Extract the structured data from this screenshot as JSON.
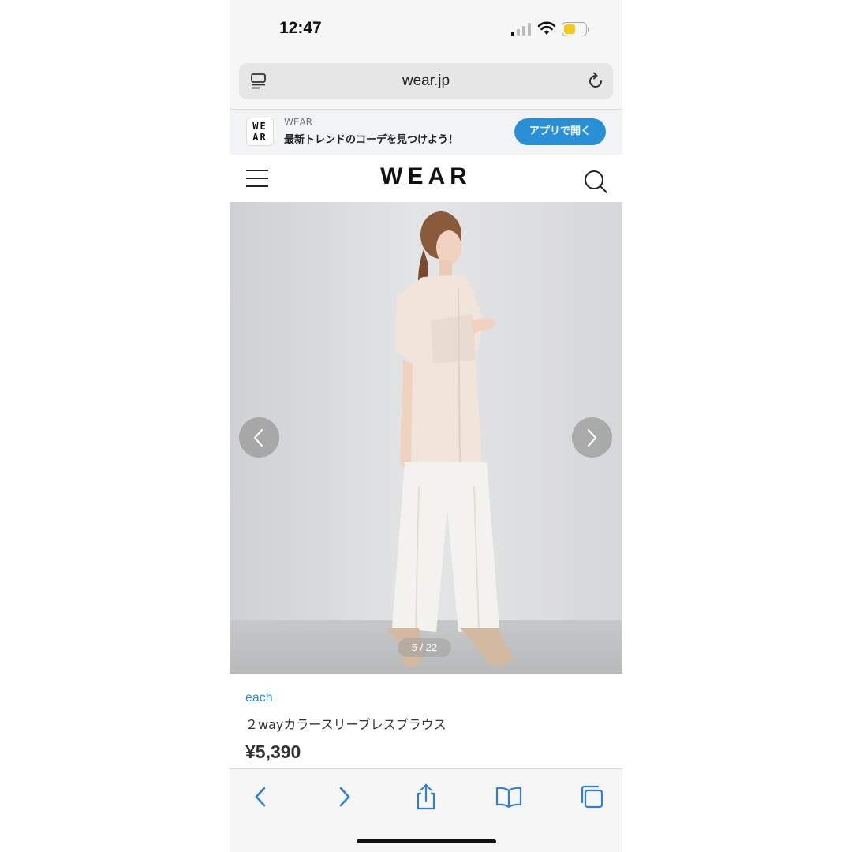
{
  "status_bar": {
    "time": "12:47"
  },
  "browser": {
    "url": "wear.jp",
    "toolbar_icons": [
      "back-icon",
      "forward-icon",
      "share-icon",
      "bookmarks-icon",
      "tabs-icon"
    ]
  },
  "app_banner": {
    "logo_line1": "WE",
    "logo_line2": "AR",
    "app_name": "WEAR",
    "tagline": "最新トレンドのコーデを見つけよう！",
    "open_button": "アプリで開く"
  },
  "header": {
    "logo": "WEAR"
  },
  "gallery": {
    "counter": "5 / 22"
  },
  "product": {
    "brand": "each",
    "name": "２wayカラースリーブレスブラウス",
    "price": "¥5,390"
  },
  "colors": {
    "accent": "#2b8fd6",
    "battery": "#f7c81d"
  }
}
